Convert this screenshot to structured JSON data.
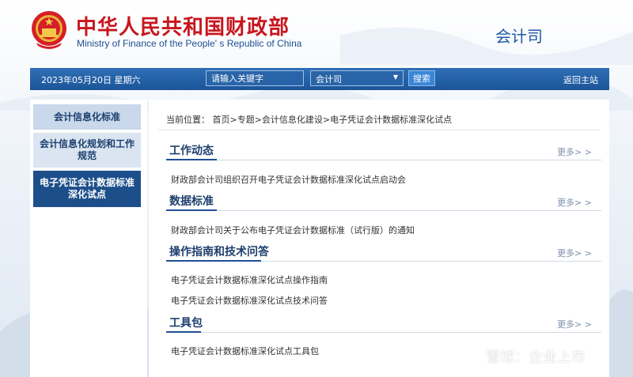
{
  "header": {
    "title_zh": "中华人民共和国财政部",
    "title_en": "Ministry of Finance of the People' s Republic of China",
    "department": "会计司"
  },
  "navbar": {
    "date": "2023年05月20日  星期六",
    "search_placeholder": "请输入关键字",
    "select_value": "会计司",
    "search_button": "搜索",
    "home_link": "返回主站"
  },
  "sidebar": {
    "items": [
      {
        "label": "会计信息化标准",
        "active": false
      },
      {
        "label": "会计信息化规划和工作规范",
        "active": false
      },
      {
        "label": "电子凭证会计数据标准深化试点",
        "active": true
      }
    ]
  },
  "breadcrumb": "当前位置：  首页>专题>会计信息化建设>电子凭证会计数据标准深化试点",
  "sections": [
    {
      "title": "工作动态",
      "more": "更多> >",
      "items": [
        "财政部会计司组织召开电子凭证会计数据标准深化试点启动会"
      ]
    },
    {
      "title": "数据标准",
      "more": "更多> >",
      "items": [
        "财政部会计司关于公布电子凭证会计数据标准（试行版）的通知"
      ]
    },
    {
      "title": "操作指南和技术问答",
      "more": "更多> >",
      "items": [
        "电子凭证会计数据标准深化试点操作指南",
        "电子凭证会计数据标准深化试点技术问答"
      ]
    },
    {
      "title": "工具包",
      "more": "更多> >",
      "items": [
        "电子凭证会计数据标准深化试点工具包"
      ]
    }
  ],
  "watermark": "雪球：企业上市",
  "colors": {
    "brand_red": "#c8161d",
    "brand_blue": "#1d4f93",
    "nav_blue": "#1b5598",
    "active_sidebar": "#1c4f8a"
  }
}
